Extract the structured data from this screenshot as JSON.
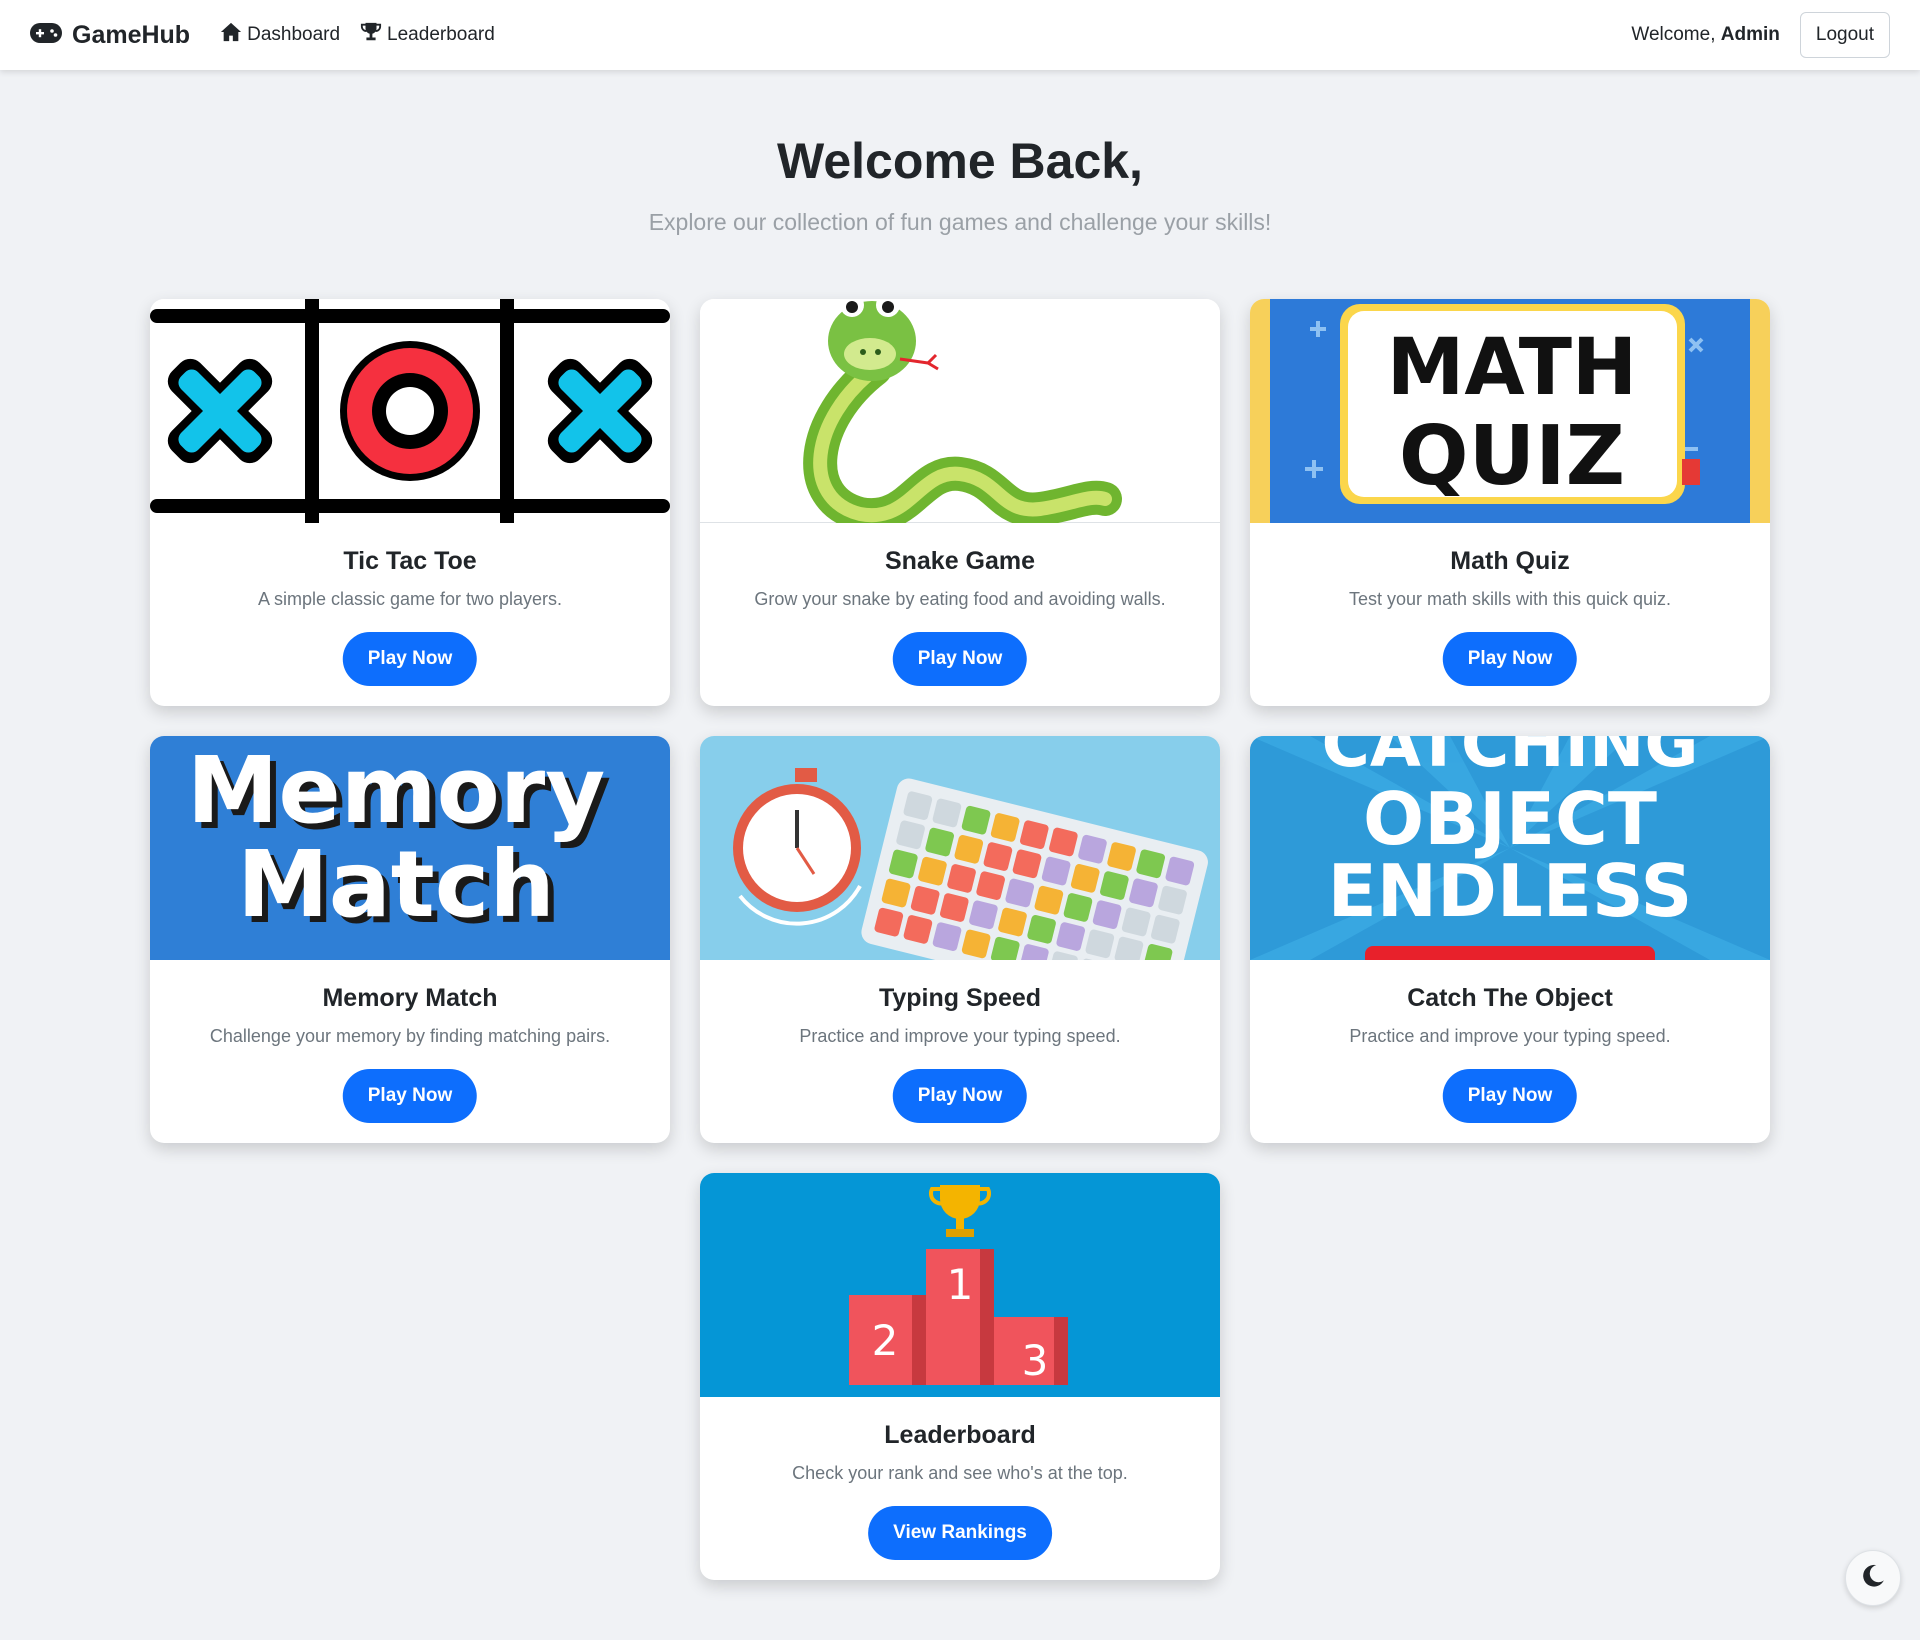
{
  "navbar": {
    "brand": "GameHub",
    "brand_icon": "gamepad-icon",
    "links": [
      {
        "label": "Dashboard",
        "icon": "home-icon"
      },
      {
        "label": "Leaderboard",
        "icon": "trophy-icon"
      }
    ],
    "welcome_prefix": "Welcome,",
    "username": "Admin",
    "logout_label": "Logout"
  },
  "hero": {
    "title": "Welcome Back,",
    "subtitle": "Explore our collection of fun games and challenge your skills!"
  },
  "games": [
    {
      "title": "Tic Tac Toe",
      "description": "A simple classic game for two players.",
      "button": "Play Now"
    },
    {
      "title": "Snake Game",
      "description": "Grow your snake by eating food and avoiding walls.",
      "button": "Play Now"
    },
    {
      "title": "Math Quiz",
      "description": "Test your math skills with this quick quiz.",
      "button": "Play Now",
      "image_text": [
        "MATH",
        "QUIZ"
      ]
    },
    {
      "title": "Memory Match",
      "description": "Challenge your memory by finding matching pairs.",
      "button": "Play Now",
      "image_text": [
        "Memory",
        "Match"
      ]
    },
    {
      "title": "Typing Speed",
      "description": "Practice and improve your typing speed.",
      "button": "Play Now"
    },
    {
      "title": "Catch The Object",
      "description": "Practice and improve your typing speed.",
      "button": "Play Now",
      "image_text": [
        "CATCHING",
        "OBJECT",
        "ENDLESS"
      ]
    },
    {
      "title": "Leaderboard",
      "description": "Check your rank and see who's at the top.",
      "button": "View Rankings",
      "image_text": [
        "1",
        "2",
        "3"
      ]
    }
  ],
  "theme_toggle_icon": "moon-icon",
  "colors": {
    "primary": "#0d6efd",
    "background": "#f0f2f5",
    "text": "#212529",
    "muted": "#6c757d"
  }
}
